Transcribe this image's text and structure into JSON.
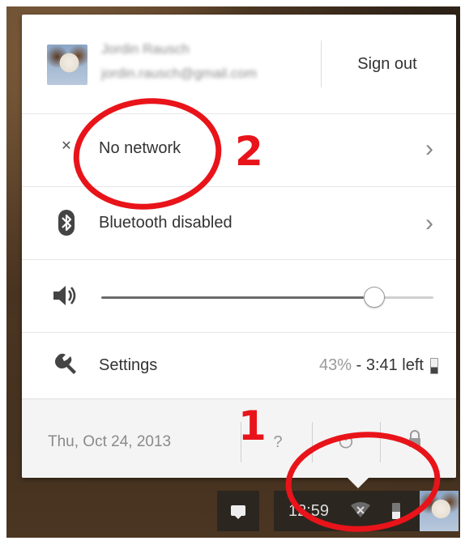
{
  "account": {
    "name": "Jordin Rausch",
    "email": "jordin.rausch@gmail.com",
    "sign_out_label": "Sign out"
  },
  "network": {
    "label": "No network",
    "icon": "network-disconnected-icon"
  },
  "bluetooth": {
    "label": "Bluetooth disabled",
    "icon": "bluetooth-icon"
  },
  "volume": {
    "icon": "speaker-icon",
    "level": 0.82
  },
  "settings": {
    "label": "Settings",
    "icon": "wrench-icon",
    "battery_percent": "43%",
    "battery_separator": " - ",
    "battery_time": "3:41 left",
    "battery_level": 0.43
  },
  "footer": {
    "date": "Thu, Oct 24, 2013",
    "help_label": "?",
    "power_icon": "power-icon",
    "lock_icon": "lock-icon"
  },
  "shelf": {
    "clock": "12:59",
    "notifications_icon": "notification-bubble-icon",
    "network_icon": "network-disconnected-icon",
    "battery_icon": "battery-icon"
  },
  "annotations": {
    "label_1": "1",
    "label_2": "2",
    "color": "#e8141a"
  }
}
